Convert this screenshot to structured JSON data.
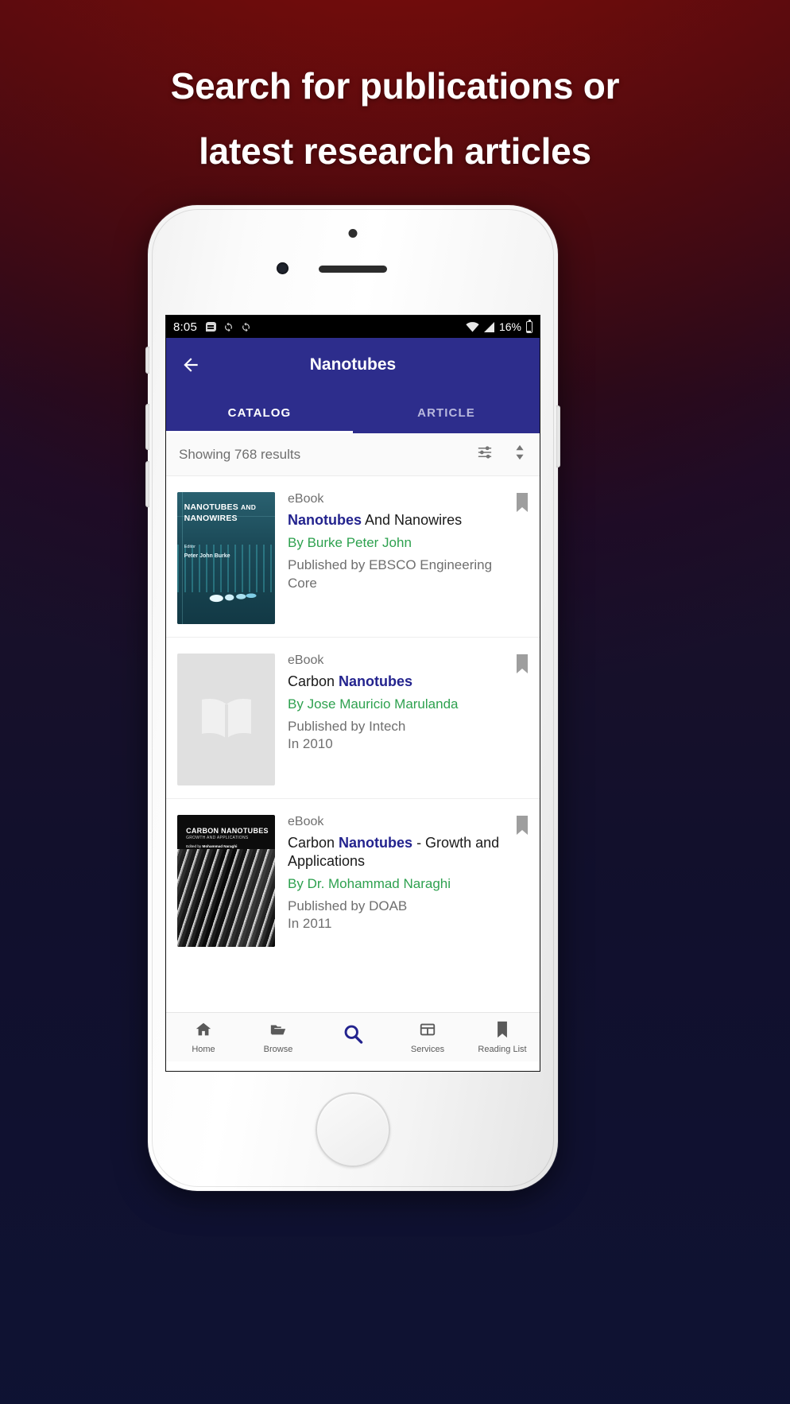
{
  "headline": {
    "line1": "Search for publications or",
    "line2": "latest research articles"
  },
  "phone": {
    "status_bar": {
      "time": "8:05",
      "battery_percent": "16%",
      "icons": [
        "message-icon",
        "sync-icon",
        "sync-icon",
        "wifi-icon",
        "signal-icon",
        "battery-icon"
      ]
    },
    "app_bar": {
      "back_icon": "arrow-left-icon",
      "title": "Nanotubes"
    },
    "tabs": [
      {
        "label": "CATALOG",
        "active": true
      },
      {
        "label": "ARTICLE",
        "active": false
      }
    ],
    "results_bar": {
      "text": "Showing 768 results",
      "filter_icon": "filter-icon",
      "sort_icon": "sort-icon"
    },
    "results": [
      {
        "type": "eBook",
        "title_highlight": "Nanotubes",
        "title_rest": " And Nanowires",
        "title_prefix": "",
        "by_label": "By ",
        "author": "Burke Peter John",
        "published": "Published by EBSCO Engineering Core",
        "year": "",
        "cover": {
          "kind": "art",
          "line1": "NANOTUBES ",
          "line1_small": "AND",
          "line2": "NANOWIRES",
          "editor_label": "Editor",
          "editor_name": "Peter John Burke"
        },
        "bookmark_icon": "bookmark-icon"
      },
      {
        "type": "eBook",
        "title_prefix": "Carbon ",
        "title_highlight": "Nanotubes",
        "title_rest": "",
        "by_label": "By ",
        "author": "Jose Mauricio Marulanda",
        "published": "Published by Intech",
        "year": "In 2010",
        "cover": {
          "kind": "placeholder",
          "icon": "open-book-icon"
        },
        "bookmark_icon": "bookmark-icon"
      },
      {
        "type": "eBook",
        "title_prefix": "Carbon ",
        "title_highlight": "Nanotubes",
        "title_rest": " - Growth and Applications",
        "by_label": "By ",
        "author": "Dr. Mohammad Naraghi",
        "published": "Published by DOAB",
        "year": "In 2011",
        "cover": {
          "kind": "art",
          "line1": "CARBON NANOTUBES",
          "line2": "GROWTH AND APPLICATIONS",
          "editor_label": "Edited by ",
          "editor_name": "Mohammad Naraghi"
        },
        "bookmark_icon": "bookmark-icon"
      }
    ],
    "bottom_nav": [
      {
        "label": "Home",
        "icon": "home-icon",
        "active": false
      },
      {
        "label": "Browse",
        "icon": "folder-icon",
        "active": false
      },
      {
        "label": "",
        "icon": "search-icon",
        "active": true
      },
      {
        "label": "Services",
        "icon": "table-icon",
        "active": false
      },
      {
        "label": "Reading List",
        "icon": "bookmark-icon",
        "active": false
      }
    ]
  },
  "colors": {
    "appbar": "#2d2d8c",
    "accent": "#23238e",
    "author": "#2ea14f",
    "muted": "#6f6f6f"
  }
}
